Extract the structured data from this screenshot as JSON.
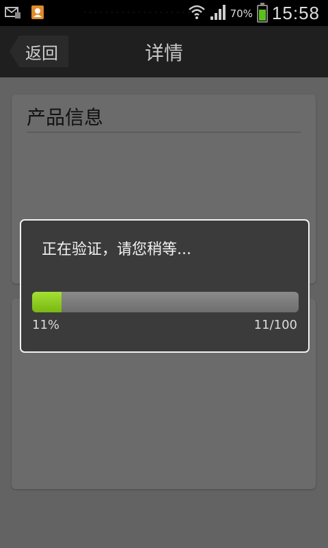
{
  "status_bar": {
    "icons": [
      "mail-icon",
      "contacts-icon",
      "wifi-icon",
      "signal-icon",
      "battery-icon"
    ],
    "battery_text": "70%",
    "time": "15:58"
  },
  "header": {
    "back_label": "返回",
    "title": "详情"
  },
  "product_card": {
    "title": "产品信息"
  },
  "dialog": {
    "message": "正在验证，请您稍等...",
    "progress_fraction": 0.11,
    "percent_text": "11%",
    "count_text": "11/100"
  },
  "colors": {
    "progress_fill": "#8ccc22",
    "title_bar": "#1f1f1f",
    "background": "#636363"
  }
}
